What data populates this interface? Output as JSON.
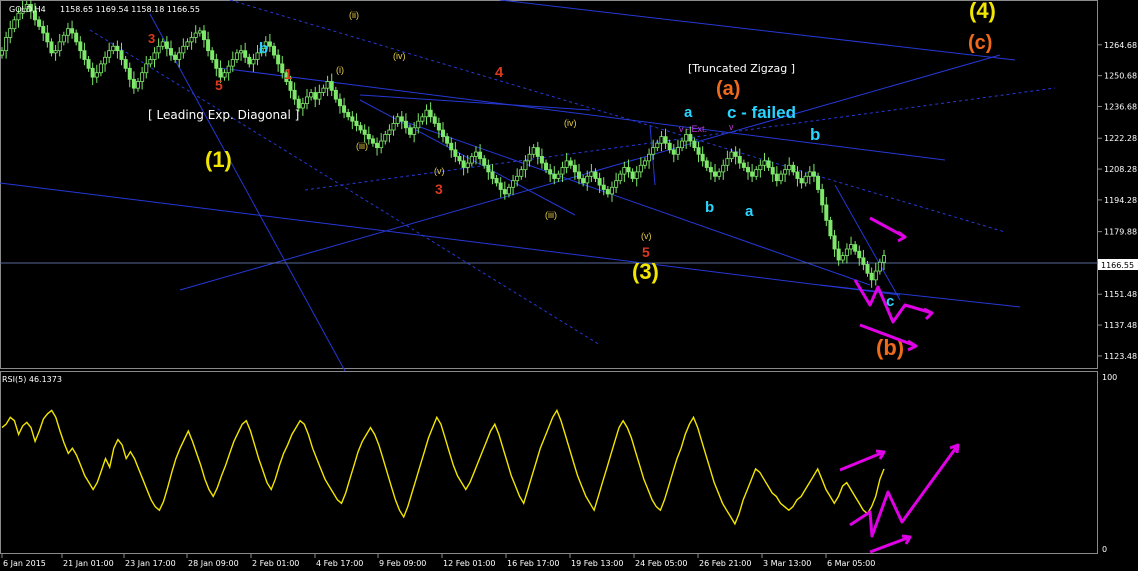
{
  "symbol_bar": {
    "symbol": "GOLD,H4",
    "quote": "1158.65 1169.54 1158.18 1166.55"
  },
  "rsi_bar": {
    "label": "RSI(5) 46.1373"
  },
  "chart_data": [
    {
      "type": "candlestick",
      "title": "",
      "ylim": [
        1118,
        1285
      ],
      "y_ticks": [
        "1264.68",
        "1250.68",
        "1236.68",
        "1222.28",
        "1208.28",
        "1194.28",
        "1179.88",
        "1165.55",
        "1151.48",
        "1137.48",
        "1123.48"
      ],
      "current_price": "1166.55",
      "x_ticks": [
        "6 Jan 2015",
        "21 Jan 01:00",
        "23 Jan 17:00",
        "28 Jan 09:00",
        "2 Feb 01:00",
        "4 Feb 17:00",
        "9 Feb 09:00",
        "12 Feb 01:00",
        "16 Feb 17:00",
        "19 Feb 13:00",
        "24 Feb 05:00",
        "26 Feb 21:00",
        "3 Mar 13:00",
        "6 Mar 05:00"
      ],
      "close_path": [
        1262,
        1268,
        1272,
        1276,
        1279,
        1281,
        1283,
        1280,
        1276,
        1273,
        1270,
        1266,
        1261,
        1262,
        1266,
        1269,
        1272,
        1270,
        1266,
        1262,
        1258,
        1254,
        1250,
        1252,
        1256,
        1259,
        1262,
        1264,
        1262,
        1258,
        1254,
        1249,
        1245,
        1248,
        1252,
        1256,
        1258,
        1261,
        1264,
        1266,
        1263,
        1260,
        1258,
        1261,
        1264,
        1266,
        1268,
        1270,
        1271,
        1267,
        1262,
        1258,
        1254,
        1250,
        1252,
        1255,
        1258,
        1261,
        1262,
        1259,
        1256,
        1258,
        1261,
        1263,
        1266,
        1264,
        1260,
        1256,
        1252,
        1248,
        1244,
        1240,
        1236,
        1238,
        1241,
        1243,
        1240,
        1243,
        1245,
        1248,
        1244,
        1240,
        1237,
        1234,
        1232,
        1230,
        1228,
        1226,
        1224,
        1222,
        1220,
        1218,
        1221,
        1224,
        1226,
        1229,
        1232,
        1230,
        1227,
        1224,
        1227,
        1230,
        1232,
        1235,
        1232,
        1229,
        1226,
        1223,
        1220,
        1217,
        1214,
        1212,
        1209,
        1211,
        1214,
        1216,
        1213,
        1210,
        1207,
        1204,
        1202,
        1199,
        1197,
        1200,
        1203,
        1205,
        1208,
        1212,
        1215,
        1218,
        1214,
        1211,
        1208,
        1206,
        1204,
        1206,
        1209,
        1212,
        1210,
        1207,
        1204,
        1202,
        1205,
        1207,
        1204,
        1201,
        1199,
        1197,
        1200,
        1203,
        1206,
        1209,
        1207,
        1204,
        1207,
        1210,
        1212,
        1215,
        1218,
        1220,
        1223,
        1220,
        1217,
        1215,
        1218,
        1221,
        1224,
        1221,
        1218,
        1215,
        1212,
        1209,
        1207,
        1205,
        1207,
        1210,
        1213,
        1216,
        1214,
        1211,
        1209,
        1207,
        1205,
        1208,
        1210,
        1212,
        1209,
        1206,
        1203,
        1206,
        1208,
        1210,
        1207,
        1204,
        1202,
        1205,
        1207,
        1205,
        1199,
        1192,
        1185,
        1178,
        1172,
        1167,
        1169,
        1172,
        1174,
        1171,
        1168,
        1165,
        1161,
        1158,
        1162,
        1166,
        1169
      ],
      "rsi": {
        "ylim": [
          0,
          100
        ],
        "y_ticks": [
          "100",
          "0"
        ],
        "values": [
          70,
          72,
          76,
          74,
          66,
          71,
          73,
          70,
          62,
          68,
          75,
          78,
          80,
          76,
          68,
          61,
          55,
          58,
          54,
          48,
          42,
          38,
          34,
          38,
          45,
          52,
          47,
          58,
          63,
          60,
          52,
          56,
          52,
          46,
          40,
          34,
          28,
          24,
          22,
          27,
          35,
          44,
          52,
          58,
          63,
          68,
          62,
          55,
          48,
          40,
          34,
          30,
          35,
          42,
          48,
          55,
          62,
          67,
          72,
          74,
          68,
          60,
          52,
          45,
          38,
          34,
          40,
          48,
          55,
          60,
          66,
          70,
          74,
          72,
          66,
          58,
          52,
          46,
          40,
          36,
          32,
          28,
          26,
          32,
          40,
          48,
          56,
          62,
          66,
          70,
          66,
          60,
          52,
          44,
          36,
          28,
          22,
          18,
          24,
          32,
          40,
          48,
          56,
          64,
          70,
          76,
          72,
          64,
          56,
          48,
          42,
          38,
          34,
          38,
          44,
          50,
          56,
          62,
          68,
          72,
          66,
          58,
          50,
          42,
          36,
          30,
          26,
          34,
          42,
          50,
          58,
          64,
          70,
          76,
          80,
          74,
          66,
          58,
          50,
          42,
          36,
          30,
          26,
          22,
          30,
          38,
          46,
          54,
          62,
          70,
          74,
          70,
          64,
          56,
          48,
          40,
          34,
          28,
          24,
          22,
          28,
          36,
          44,
          52,
          58,
          66,
          72,
          76,
          70,
          62,
          54,
          46,
          38,
          32,
          26,
          22,
          18,
          14,
          20,
          28,
          34,
          40,
          46,
          44,
          40,
          36,
          32,
          30,
          26,
          24,
          22,
          24,
          28,
          30,
          34,
          38,
          42,
          46,
          40,
          34,
          30,
          26,
          30,
          36,
          38,
          34,
          30,
          26,
          22,
          20,
          24,
          30,
          40,
          46
        ]
      },
      "wave_labels": [
        {
          "text": "3",
          "color": "#d93a1f"
        },
        {
          "text": "5",
          "color": "#d93a1f"
        },
        {
          "text": "b",
          "color": "#2ad4ff"
        },
        {
          "text": "1",
          "color": "#d93a1f"
        },
        {
          "text": "(i)",
          "color": "#e8d24a"
        },
        {
          "text": "(ii)",
          "color": "#e8d24a"
        },
        {
          "text": "(iii)",
          "color": "#e8d24a"
        },
        {
          "text": "(iv)",
          "color": "#e8d24a"
        },
        {
          "text": "(v)",
          "color": "#e8d24a"
        },
        {
          "text": "3",
          "color": "#d93a1f"
        },
        {
          "text": "4",
          "color": "#d93a1f"
        },
        {
          "text": "(1)",
          "color": "#f2e600"
        },
        {
          "text": "(3)",
          "color": "#f2e600"
        },
        {
          "text": "(4)",
          "color": "#f2e600"
        },
        {
          "text": "(a)",
          "color": "#f06a1c"
        },
        {
          "text": "(b)",
          "color": "#f06a1c"
        },
        {
          "text": "(c)",
          "color": "#f06a1c"
        },
        {
          "text": "a",
          "color": "#2ad4ff"
        },
        {
          "text": "b",
          "color": "#2ad4ff"
        },
        {
          "text": "c - failed",
          "color": "#2ad4ff"
        },
        {
          "text": "a",
          "color": "#2ad4ff"
        },
        {
          "text": "b",
          "color": "#2ad4ff"
        },
        {
          "text": "c",
          "color": "#2ad4ff"
        },
        {
          "text": "5",
          "color": "#d93a1f"
        },
        {
          "text": "(iii)",
          "color": "#e8d24a"
        },
        {
          "text": "(iv)",
          "color": "#e8d24a"
        },
        {
          "text": "(v)",
          "color": "#e8d24a"
        },
        {
          "text": "v - Ext.",
          "color": "#c23bd8"
        },
        {
          "text": "v",
          "color": "#c23bd8"
        }
      ],
      "annotations": {
        "leading_diagonal": "[ Leading Exp. Diagonal ]",
        "truncated_zigzag": "[Truncated Zigzag ]"
      },
      "colors": {
        "candles": "#7ee86b",
        "rsi_line": "#f2e600",
        "trend_lines": "#2638d6",
        "arrows": "#e000e6"
      }
    }
  ]
}
